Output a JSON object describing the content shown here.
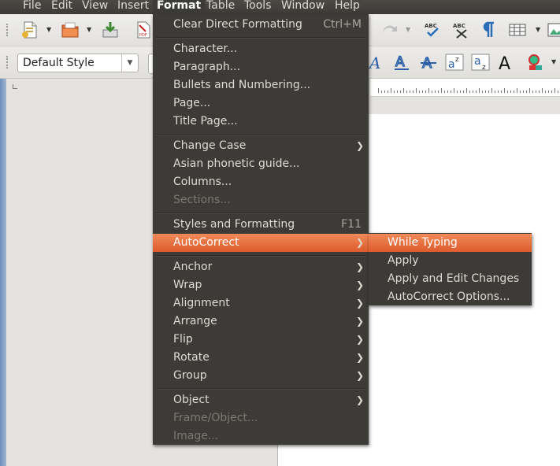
{
  "menubar": {
    "items": [
      "File",
      "Edit",
      "View",
      "Insert",
      "Format",
      "Table",
      "Tools",
      "Window",
      "Help"
    ],
    "active": "Format"
  },
  "toolbar": {
    "paragraph_style": "Default Style"
  },
  "format_menu": {
    "items": [
      {
        "label": "Clear Direct Formatting",
        "accel": "Ctrl+M"
      },
      {
        "label": "Character..."
      },
      {
        "label": "Paragraph..."
      },
      {
        "label": "Bullets and Numbering..."
      },
      {
        "label": "Page..."
      },
      {
        "label": "Title Page..."
      },
      {
        "label": "Change Case",
        "submenu": true
      },
      {
        "label": "Asian phonetic guide..."
      },
      {
        "label": "Columns..."
      },
      {
        "label": "Sections...",
        "disabled": true
      },
      {
        "label": "Styles and Formatting",
        "accel": "F11"
      },
      {
        "label": "AutoCorrect",
        "submenu": true,
        "highlighted": true
      },
      {
        "label": "Anchor",
        "submenu": true
      },
      {
        "label": "Wrap",
        "submenu": true
      },
      {
        "label": "Alignment",
        "submenu": true
      },
      {
        "label": "Arrange",
        "submenu": true
      },
      {
        "label": "Flip",
        "submenu": true
      },
      {
        "label": "Rotate",
        "submenu": true
      },
      {
        "label": "Group",
        "submenu": true
      },
      {
        "label": "Object",
        "submenu": true
      },
      {
        "label": "Frame/Object...",
        "disabled": true
      },
      {
        "label": "Image...",
        "disabled": true
      }
    ]
  },
  "autocorrect_submenu": {
    "items": [
      {
        "label": "While Typing",
        "highlighted": true
      },
      {
        "label": "Apply"
      },
      {
        "label": "Apply and Edit Changes"
      },
      {
        "label": "AutoCorrect Options..."
      }
    ]
  },
  "colors": {
    "menu_bg": "#3c3b37",
    "menu_text": "#dfdbd2",
    "highlight": "#e9682f",
    "disabled_text": "#7b786f"
  }
}
